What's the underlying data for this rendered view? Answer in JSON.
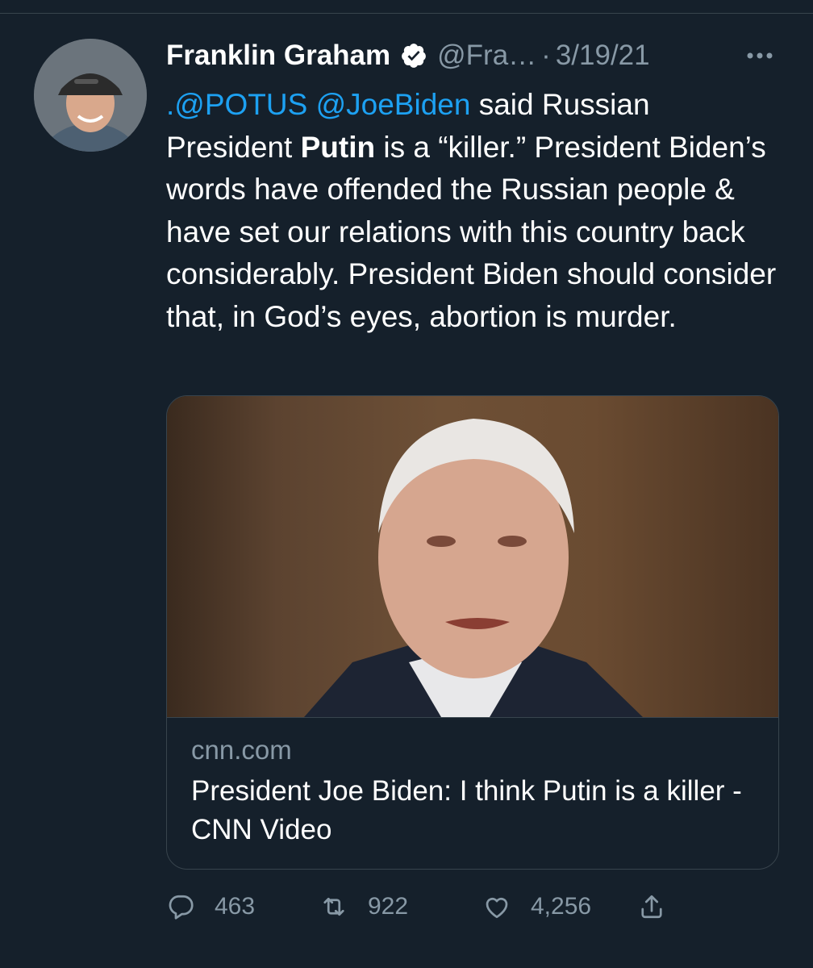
{
  "tweet": {
    "author": {
      "display_name": "Franklin Graham",
      "handle": "@Fra…",
      "avatar_icon": "profile-photo"
    },
    "separator": "·",
    "date": "3/19/21",
    "text": {
      "mention_potus": ".@POTUS",
      "mention_joebiden": "@JoeBiden",
      "part1": " said Russian President ",
      "bold_putin": "Putin",
      "part2": " is a “killer.” President Biden’s words have offended the Russian people & have set our relations with this country back considerably. President Biden should consider that, in God’s eyes, abortion is murder."
    },
    "link_card": {
      "domain": "cnn.com",
      "title": "President Joe Biden: I think Putin is a killer - CNN Video"
    },
    "actions": {
      "replies": "463",
      "retweets": "922",
      "likes": "4,256"
    }
  },
  "colors": {
    "background": "#15202b",
    "link": "#1da1f2",
    "muted": "#8899a6",
    "border": "#38444d"
  }
}
